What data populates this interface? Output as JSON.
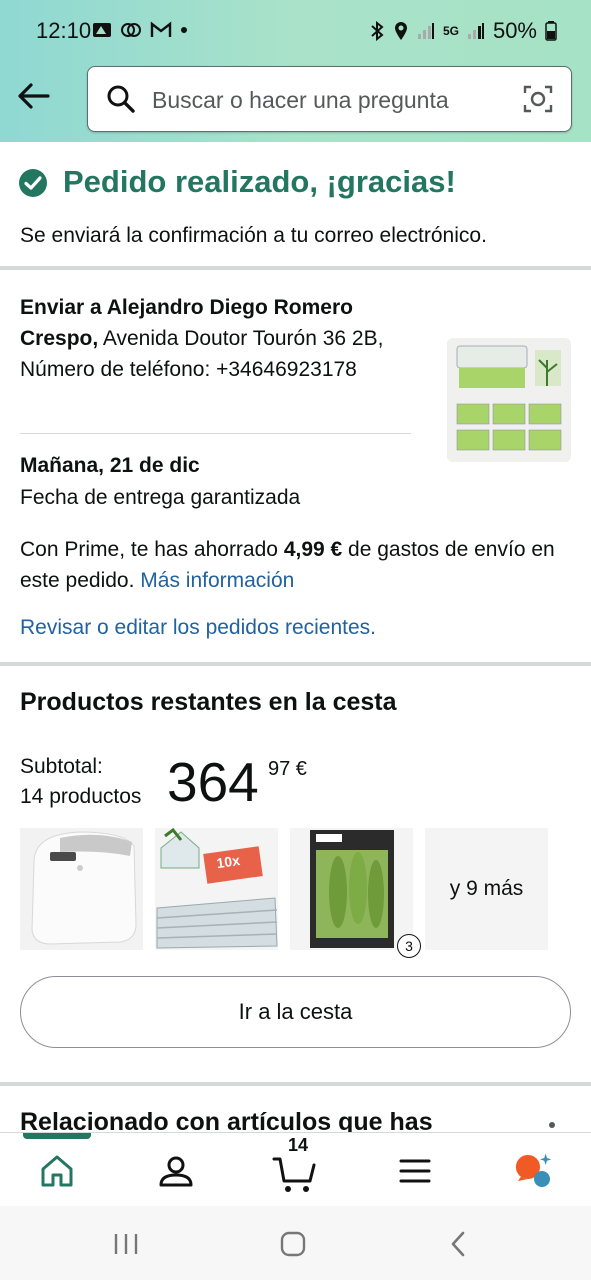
{
  "status_bar": {
    "time": "12:10",
    "battery": "50%",
    "network": "5G"
  },
  "header": {
    "search_placeholder": "Buscar o hacer una pregunta",
    "icons": [
      "back-arrow-icon",
      "search-icon",
      "camera-icon"
    ]
  },
  "confirmation": {
    "title": "Pedido realizado, ¡gracias!",
    "subtitle": "Se enviará la confirmación a tu correo electrónico."
  },
  "shipping": {
    "send_to_bold": "Enviar a Alejandro Diego Romero Crespo,",
    "address_rest": " Avenida Doutor Tourón 36 2B, Número de teléfono: +34646923178",
    "delivery_date": "Mañana, 21 de dic",
    "delivery_note": "Fecha de entrega garantizada",
    "prime_prefix": "Con Prime, te has ahorrado ",
    "prime_amount": "4,99 €",
    "prime_suffix": " de gastos de envío en este pedido. ",
    "more_info": "Más información",
    "review_link": "Revisar o editar los pedidos recientes."
  },
  "cart": {
    "title": "Productos restantes en la cesta",
    "subtotal_label": "Subtotal:",
    "count_label": "14 productos",
    "price_whole": "364",
    "price_fraction": "97 €",
    "third_item_qty": "3",
    "more_label": "y 9 más",
    "button": "Ir a la cesta"
  },
  "related": {
    "title": "Relacionado con artículos que has"
  },
  "bottom_nav": {
    "cart_count": "14",
    "items": [
      "home-icon",
      "account-icon",
      "cart-icon",
      "menu-icon",
      "rufus-icon"
    ]
  },
  "colors": {
    "accent_green": "#237660",
    "link_blue": "#2162a1",
    "header_gradient_start": "#8fd8d3",
    "header_gradient_end": "#a6e2c6"
  }
}
